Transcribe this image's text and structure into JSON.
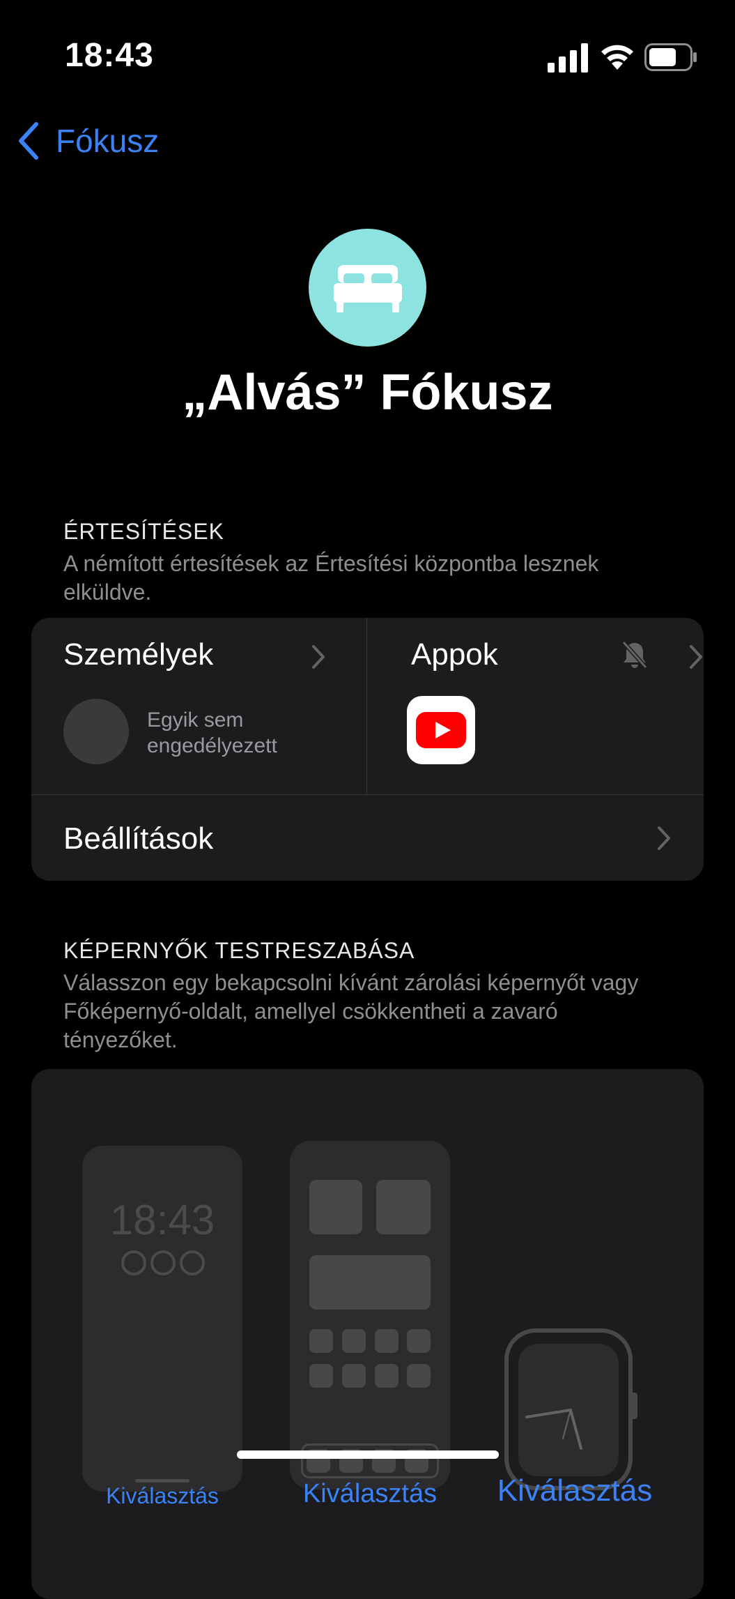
{
  "status_bar": {
    "time": "18:43"
  },
  "nav": {
    "back_label": "Fókusz"
  },
  "header": {
    "title": "„Alvás” Fókusz"
  },
  "notifications": {
    "title": "ÉRTESÍTÉSEK",
    "subtitle": "A némított értesítések az Értesítési központba lesznek elküldve.",
    "people_label": "Személyek",
    "people_none": "Egyik sem engedélyezett",
    "apps_label": "Appok",
    "apps": [
      "YouTube"
    ],
    "settings_label": "Beállítások"
  },
  "screens": {
    "title": "KÉPERNYŐK TESTRESZABÁSA",
    "subtitle": "Válasszon egy bekapcsolni kívánt zárolási képernyőt vagy Főképernyő-oldalt, amellyel csökkentheti a zavaró tényezőket.",
    "lock_preview_time": "18:43",
    "lock_pick_label": "Kiválasztás",
    "home_pick_label": "Kiválasztás",
    "watch_pick_label": "Kiválasztás"
  },
  "colors": {
    "accent": "#3b82f6",
    "focus_icon_bg": "#8de3df",
    "card_bg": "#1c1c1e"
  },
  "icons": [
    "signal-icon",
    "wifi-icon",
    "battery-icon",
    "chevron-left-icon",
    "bed-icon",
    "chevron-right-icon",
    "bell-slash-icon",
    "youtube-icon",
    "watch-icon"
  ]
}
